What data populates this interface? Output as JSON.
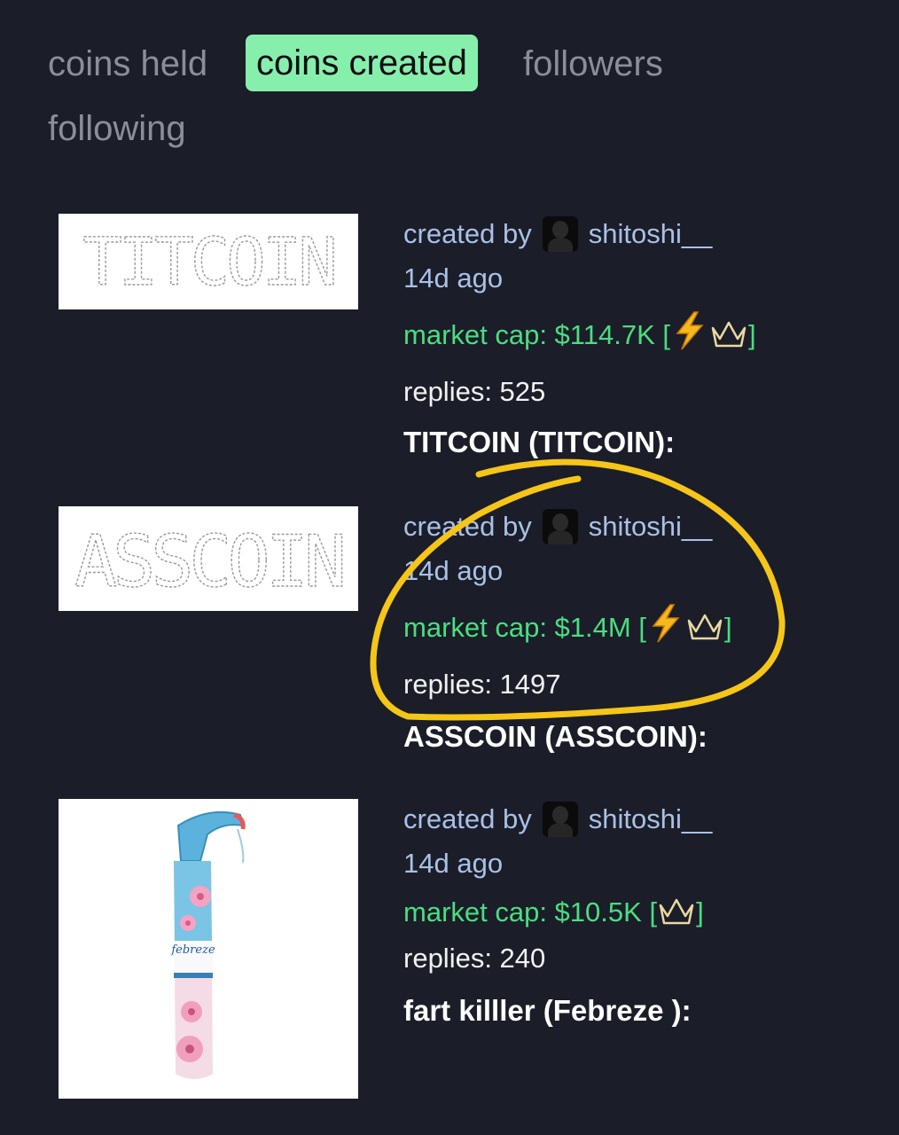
{
  "tabs": [
    {
      "label": "coins held",
      "active": false
    },
    {
      "label": "coins created",
      "active": true
    },
    {
      "label": "followers",
      "active": false
    },
    {
      "label": "following",
      "active": false
    }
  ],
  "coins": [
    {
      "image_text": "TITCOIN",
      "created_by_label": "created by",
      "creator": "shitoshi__",
      "age": "14d ago",
      "market_cap": "market cap: $114.7K",
      "badges": [
        "lightning-icon",
        "crown-icon"
      ],
      "replies": "replies: 525",
      "name": "TITCOIN (TITCOIN):"
    },
    {
      "image_text": "ASSCOIN",
      "created_by_label": "created by",
      "creator": "shitoshi__",
      "age": "14d ago",
      "market_cap": "market cap: $1.4M",
      "badges": [
        "lightning-icon",
        "crown-icon"
      ],
      "replies": "replies: 1497",
      "name": "ASSCOIN (ASSCOIN):"
    },
    {
      "image_text": "febreze",
      "created_by_label": "created by",
      "creator": "shitoshi__",
      "age": "14d ago",
      "market_cap": "market cap: $10.5K",
      "badges": [
        "crown-icon"
      ],
      "replies": "replies: 240",
      "name": "fart killler (Febreze ):"
    }
  ],
  "colors": {
    "background": "#1b1d29",
    "active_tab": "#86efac",
    "market_cap": "#4ade80",
    "muted_text": "#a9c1e6",
    "annotation": "#f5c518"
  }
}
